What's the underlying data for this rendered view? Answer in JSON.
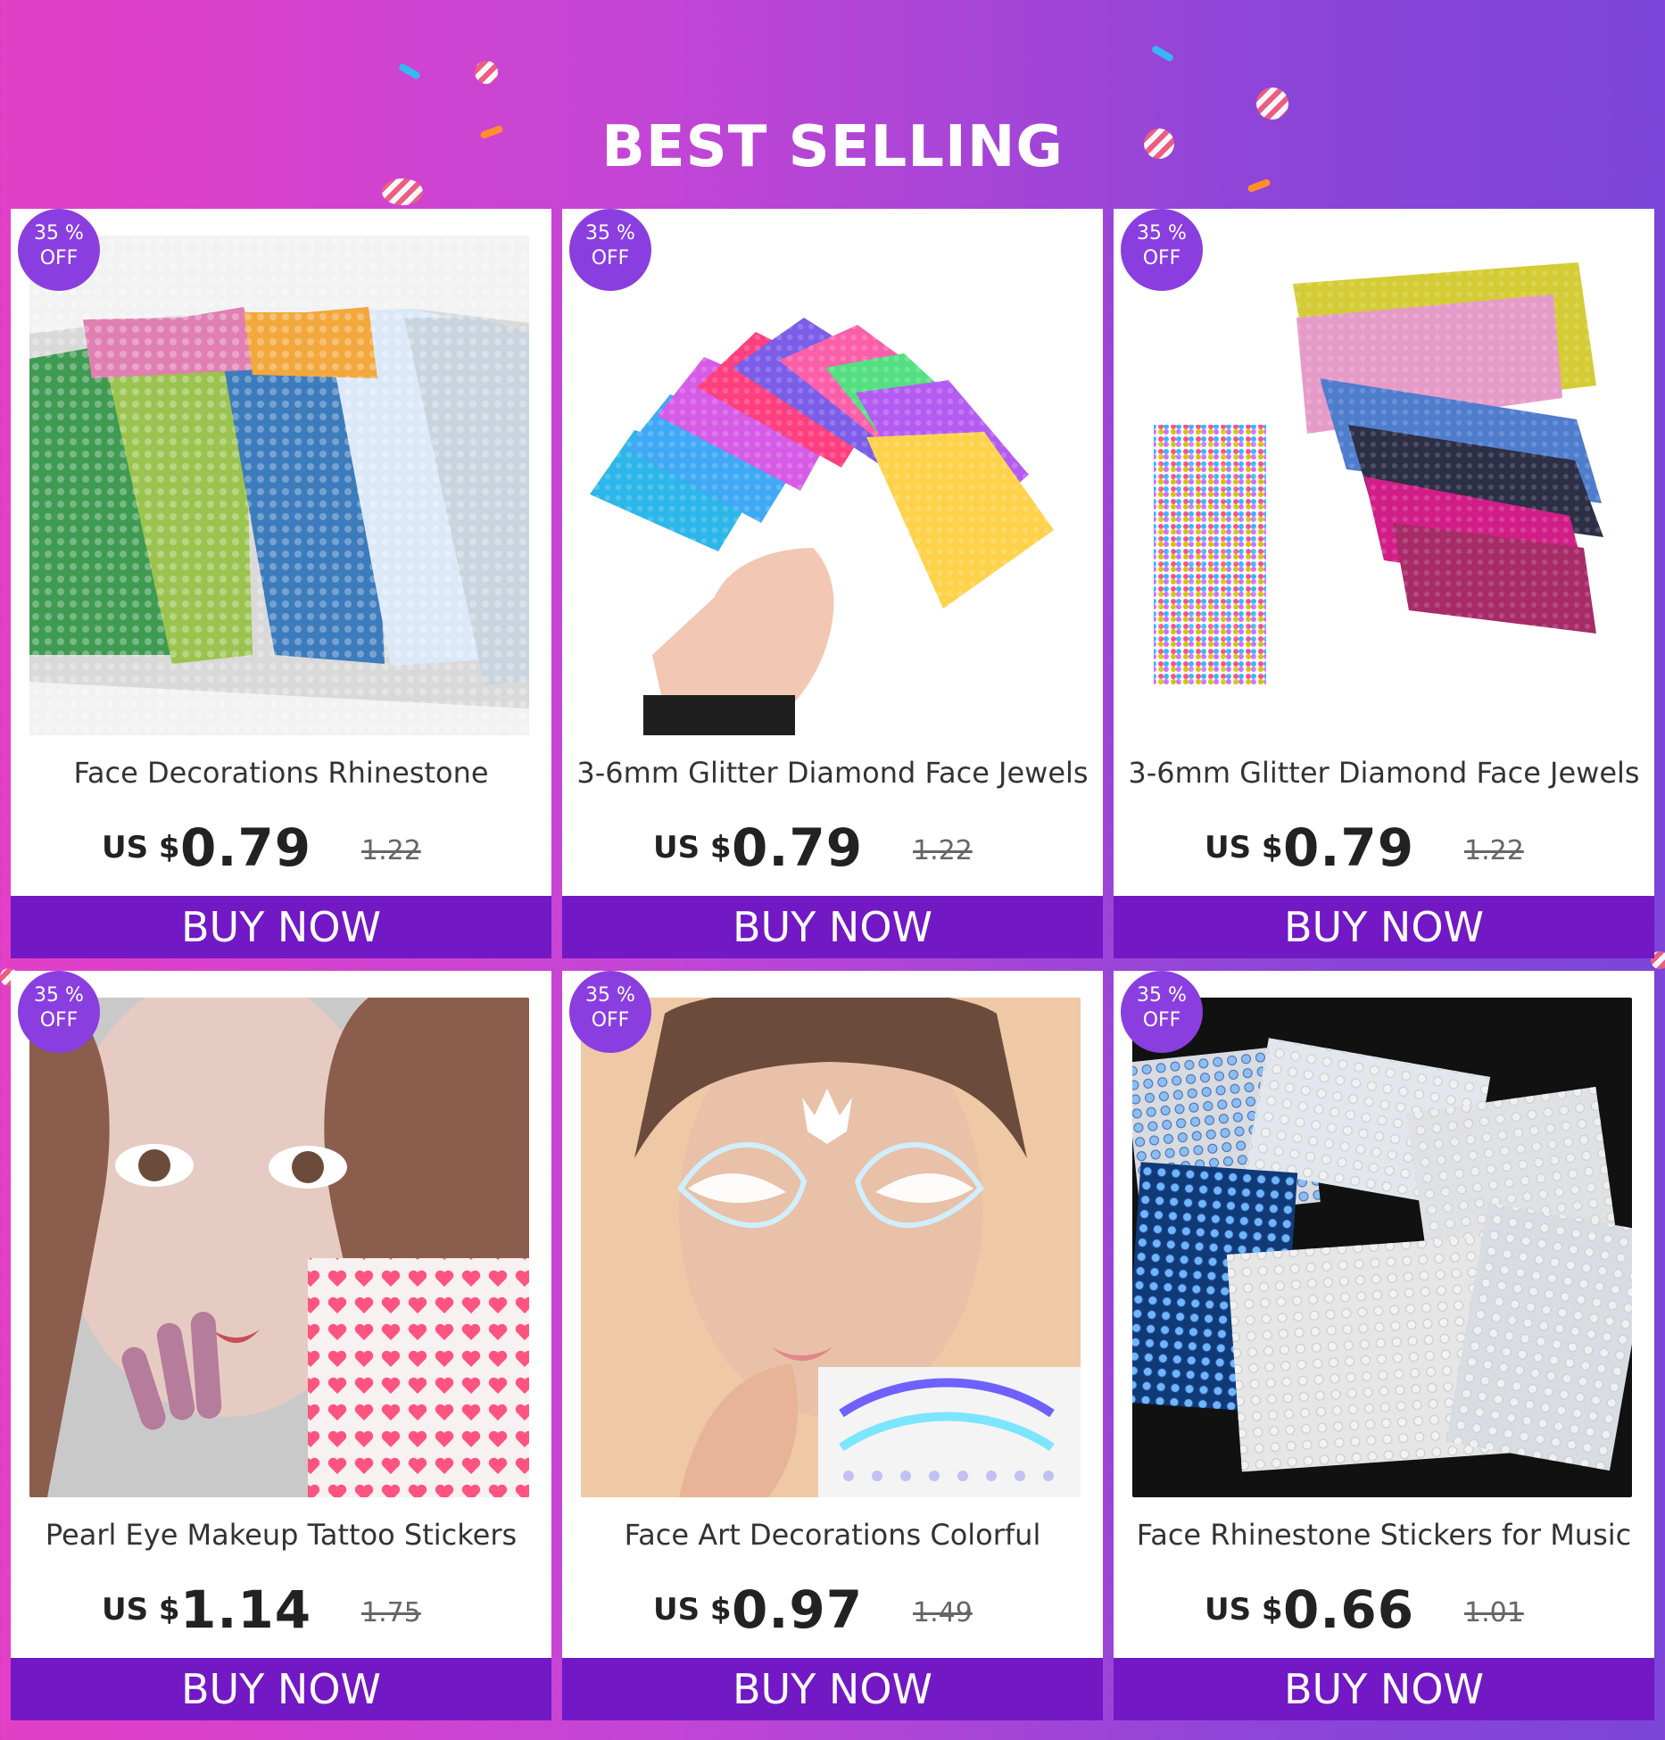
{
  "page": {
    "title": "BEST SELLING"
  },
  "products": [
    {
      "discount_line1": "35 %",
      "discount_line2": "OFF",
      "name": "Face Decorations Rhinestone",
      "currency": "US $",
      "price": "0.79",
      "old_price": "1.22",
      "button": "BUY NOW"
    },
    {
      "discount_line1": "35 %",
      "discount_line2": "OFF",
      "name": "3-6mm Glitter Diamond Face Jewels",
      "currency": "US $",
      "price": "0.79",
      "old_price": "1.22",
      "button": "BUY NOW"
    },
    {
      "discount_line1": "35 %",
      "discount_line2": "OFF",
      "name": "3-6mm Glitter Diamond Face Jewels",
      "currency": "US $",
      "price": "0.79",
      "old_price": "1.22",
      "button": "BUY NOW"
    },
    {
      "discount_line1": "35 %",
      "discount_line2": "OFF",
      "name": "Pearl Eye Makeup Tattoo Stickers",
      "currency": "US $",
      "price": "1.14",
      "old_price": "1.75",
      "button": "BUY NOW"
    },
    {
      "discount_line1": "35 %",
      "discount_line2": "OFF",
      "name": "Face Art Decorations Colorful",
      "currency": "US $",
      "price": "0.97",
      "old_price": "1.49",
      "button": "BUY NOW"
    },
    {
      "discount_line1": "35 %",
      "discount_line2": "OFF",
      "name": "Face Rhinestone Stickers for Music",
      "currency": "US $",
      "price": "0.66",
      "old_price": "1.01",
      "button": "BUY NOW"
    }
  ]
}
